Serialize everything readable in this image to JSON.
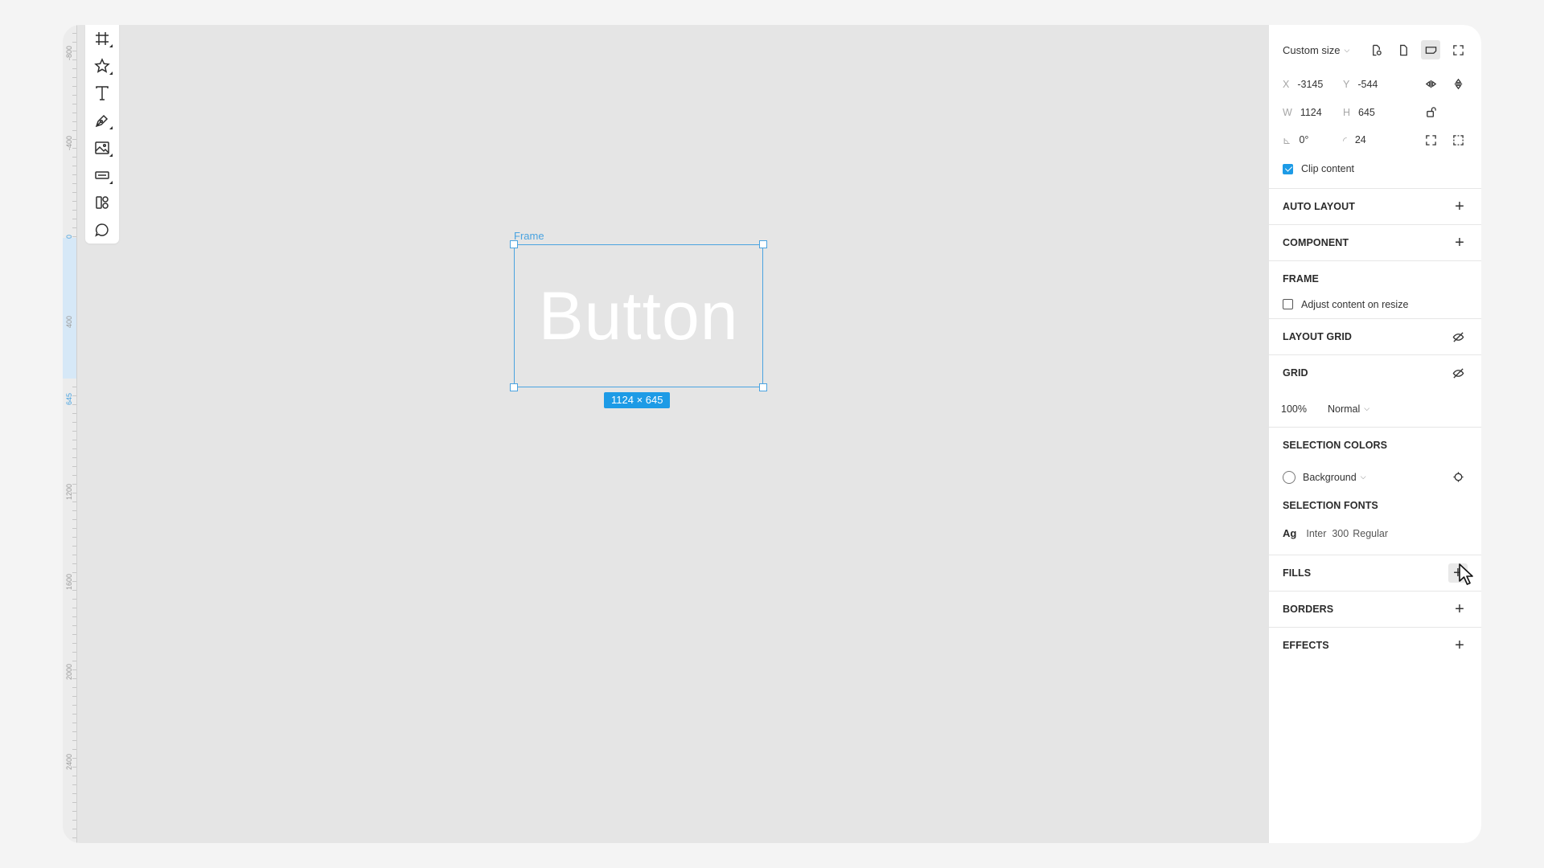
{
  "ruler": {
    "labels": [
      "-800",
      "-400",
      "0",
      "400",
      "645",
      "1200",
      "1600",
      "2000",
      "2400"
    ]
  },
  "toolbar": {
    "tools": [
      "frame-tool",
      "star-tool",
      "text-tool",
      "pen-tool",
      "image-tool",
      "rectangle-tool",
      "components-tool",
      "comment-tool"
    ]
  },
  "canvas": {
    "frame_label": "Frame",
    "frame_text": "Button",
    "size_badge": "1124 × 645"
  },
  "panel": {
    "size_preset": "Custom size",
    "x_label": "X",
    "x_value": "-3145",
    "y_label": "Y",
    "y_value": "-544",
    "w_label": "W",
    "w_value": "1124",
    "h_label": "H",
    "h_value": "645",
    "rotation_value": "0°",
    "radius_value": "24",
    "clip_content_label": "Clip content",
    "clip_content_checked": true,
    "auto_layout": "AUTO LAYOUT",
    "component": "COMPONENT",
    "frame": "FRAME",
    "adjust_content_label": "Adjust content on resize",
    "layout_grid": "LAYOUT GRID",
    "grid": "GRID",
    "opacity": "100%",
    "blend_mode": "Normal",
    "selection_colors": "SELECTION COLORS",
    "background_color_label": "Background",
    "selection_fonts": "SELECTION FONTS",
    "font_sample": "Ag",
    "font_name": "Inter",
    "font_weight": "300",
    "font_style": "Regular",
    "fills": "FILLS",
    "borders": "BORDERS",
    "effects": "EFFECTS"
  },
  "colors": {
    "accent": "#1d9be6",
    "frame_outline": "#4aa3e0",
    "canvas": "#e5e5e5"
  }
}
